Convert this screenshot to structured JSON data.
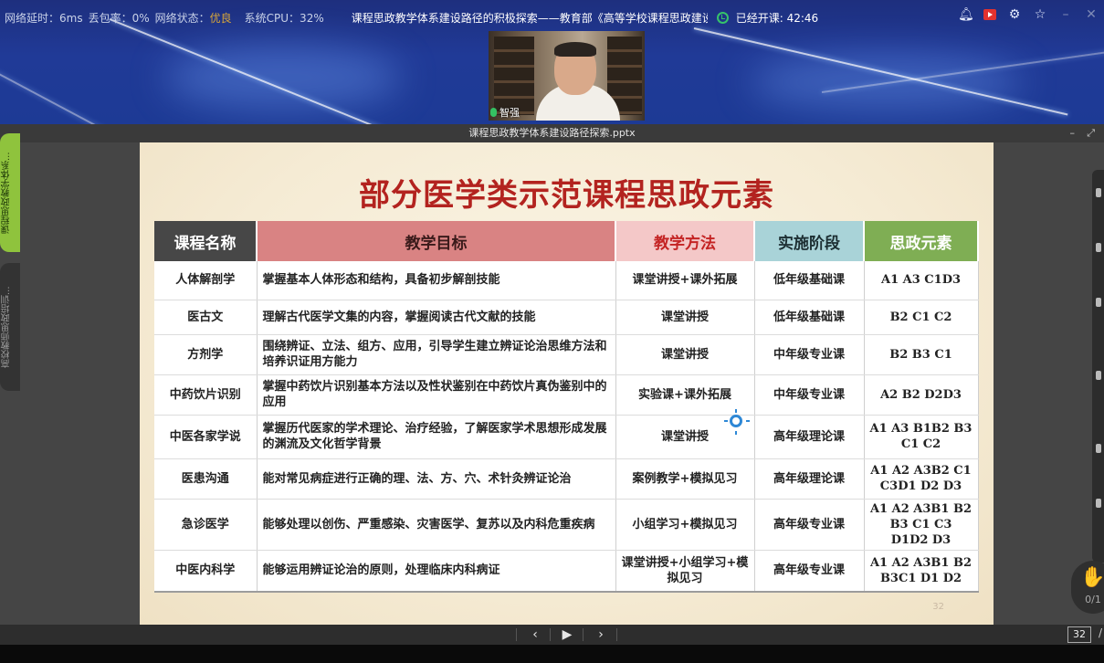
{
  "status_bar": {
    "latency": "网络延时：6ms",
    "packet_loss": "丢包率：0%",
    "network_label": "网络状态：",
    "network_status": "优良",
    "cpu": "系统CPU：32%",
    "session_title": "课程思政教学体系建设路径的积极探索——教育部《高等学校课程思政建设",
    "elapsed": "已经开课: 42:46"
  },
  "window_controls": [
    "bell-icon",
    "record-icon",
    "gear-icon",
    "pin-icon",
    "minimize-icon",
    "close-icon"
  ],
  "presenter": {
    "name": "智强"
  },
  "viewer": {
    "file_name": "课程思政教学体系建设路径探索.pptx",
    "left_tabs": [
      "课程思政教学体系...",
      "高校教师思政培训..."
    ]
  },
  "slide": {
    "title": "部分医学类示范课程思政元素",
    "headers": [
      "课程名称",
      "教学目标",
      "教学方法",
      "实施阶段",
      "思政元素"
    ],
    "rows": [
      {
        "name": "人体解剖学",
        "goal": "掌握基本人体形态和结构，具备初步解剖技能",
        "method": "课堂讲授+课外拓展",
        "stage": "低年级基础课",
        "elements": "A1 A3 C1D3"
      },
      {
        "name": "医古文",
        "goal": "理解古代医学文集的内容，掌握阅读古代文献的技能",
        "method": "课堂讲授",
        "stage": "低年级基础课",
        "elements": "B2 C1 C2"
      },
      {
        "name": "方剂学",
        "goal": "围绕辨证、立法、组方、应用，引导学生建立辨证论治思维方法和培养识证用方能力",
        "method": "课堂讲授",
        "stage": "中年级专业课",
        "elements": "B2 B3 C1"
      },
      {
        "name": "中药饮片识别",
        "goal": "掌握中药饮片识别基本方法以及性状鉴别在中药饮片真伪鉴别中的应用",
        "method": "实验课+课外拓展",
        "stage": "中年级专业课",
        "elements": "A2 B2 D2D3"
      },
      {
        "name": "中医各家学说",
        "goal": "掌握历代医家的学术理论、治疗经验，了解医家学术思想形成发展的渊流及文化哲学背景",
        "method": "课堂讲授",
        "stage": "高年级理论课",
        "elements": "A1 A3 B1B2 B3 C1 C2"
      },
      {
        "name": "医患沟通",
        "goal": "能对常见病症进行正确的理、法、方、穴、术针灸辨证论治",
        "method": "案例教学+模拟见习",
        "stage": "高年级理论课",
        "elements": "A1 A2 A3B2 C1 C3D1 D2 D3"
      },
      {
        "name": "急诊医学",
        "goal": "能够处理以创伤、严重感染、灾害医学、复苏以及内科危重疾病",
        "method": "小组学习+模拟见习",
        "stage": "高年级专业课",
        "elements": "A1 A2 A3B1 B2 B3 C1 C3 D1D2 D3"
      },
      {
        "name": "中医内科学",
        "goal": "能够运用辨证论治的原则，处理临床内科病证",
        "method": "课堂讲授+小组学习+模拟见习",
        "stage": "高年级专业课",
        "elements": "A1 A2 A3B1 B2 B3C1 D1 D2"
      }
    ],
    "slide_number": "32"
  },
  "raise_hand": {
    "count": "0/1"
  },
  "nav": {
    "page": "32",
    "slash": "/"
  }
}
